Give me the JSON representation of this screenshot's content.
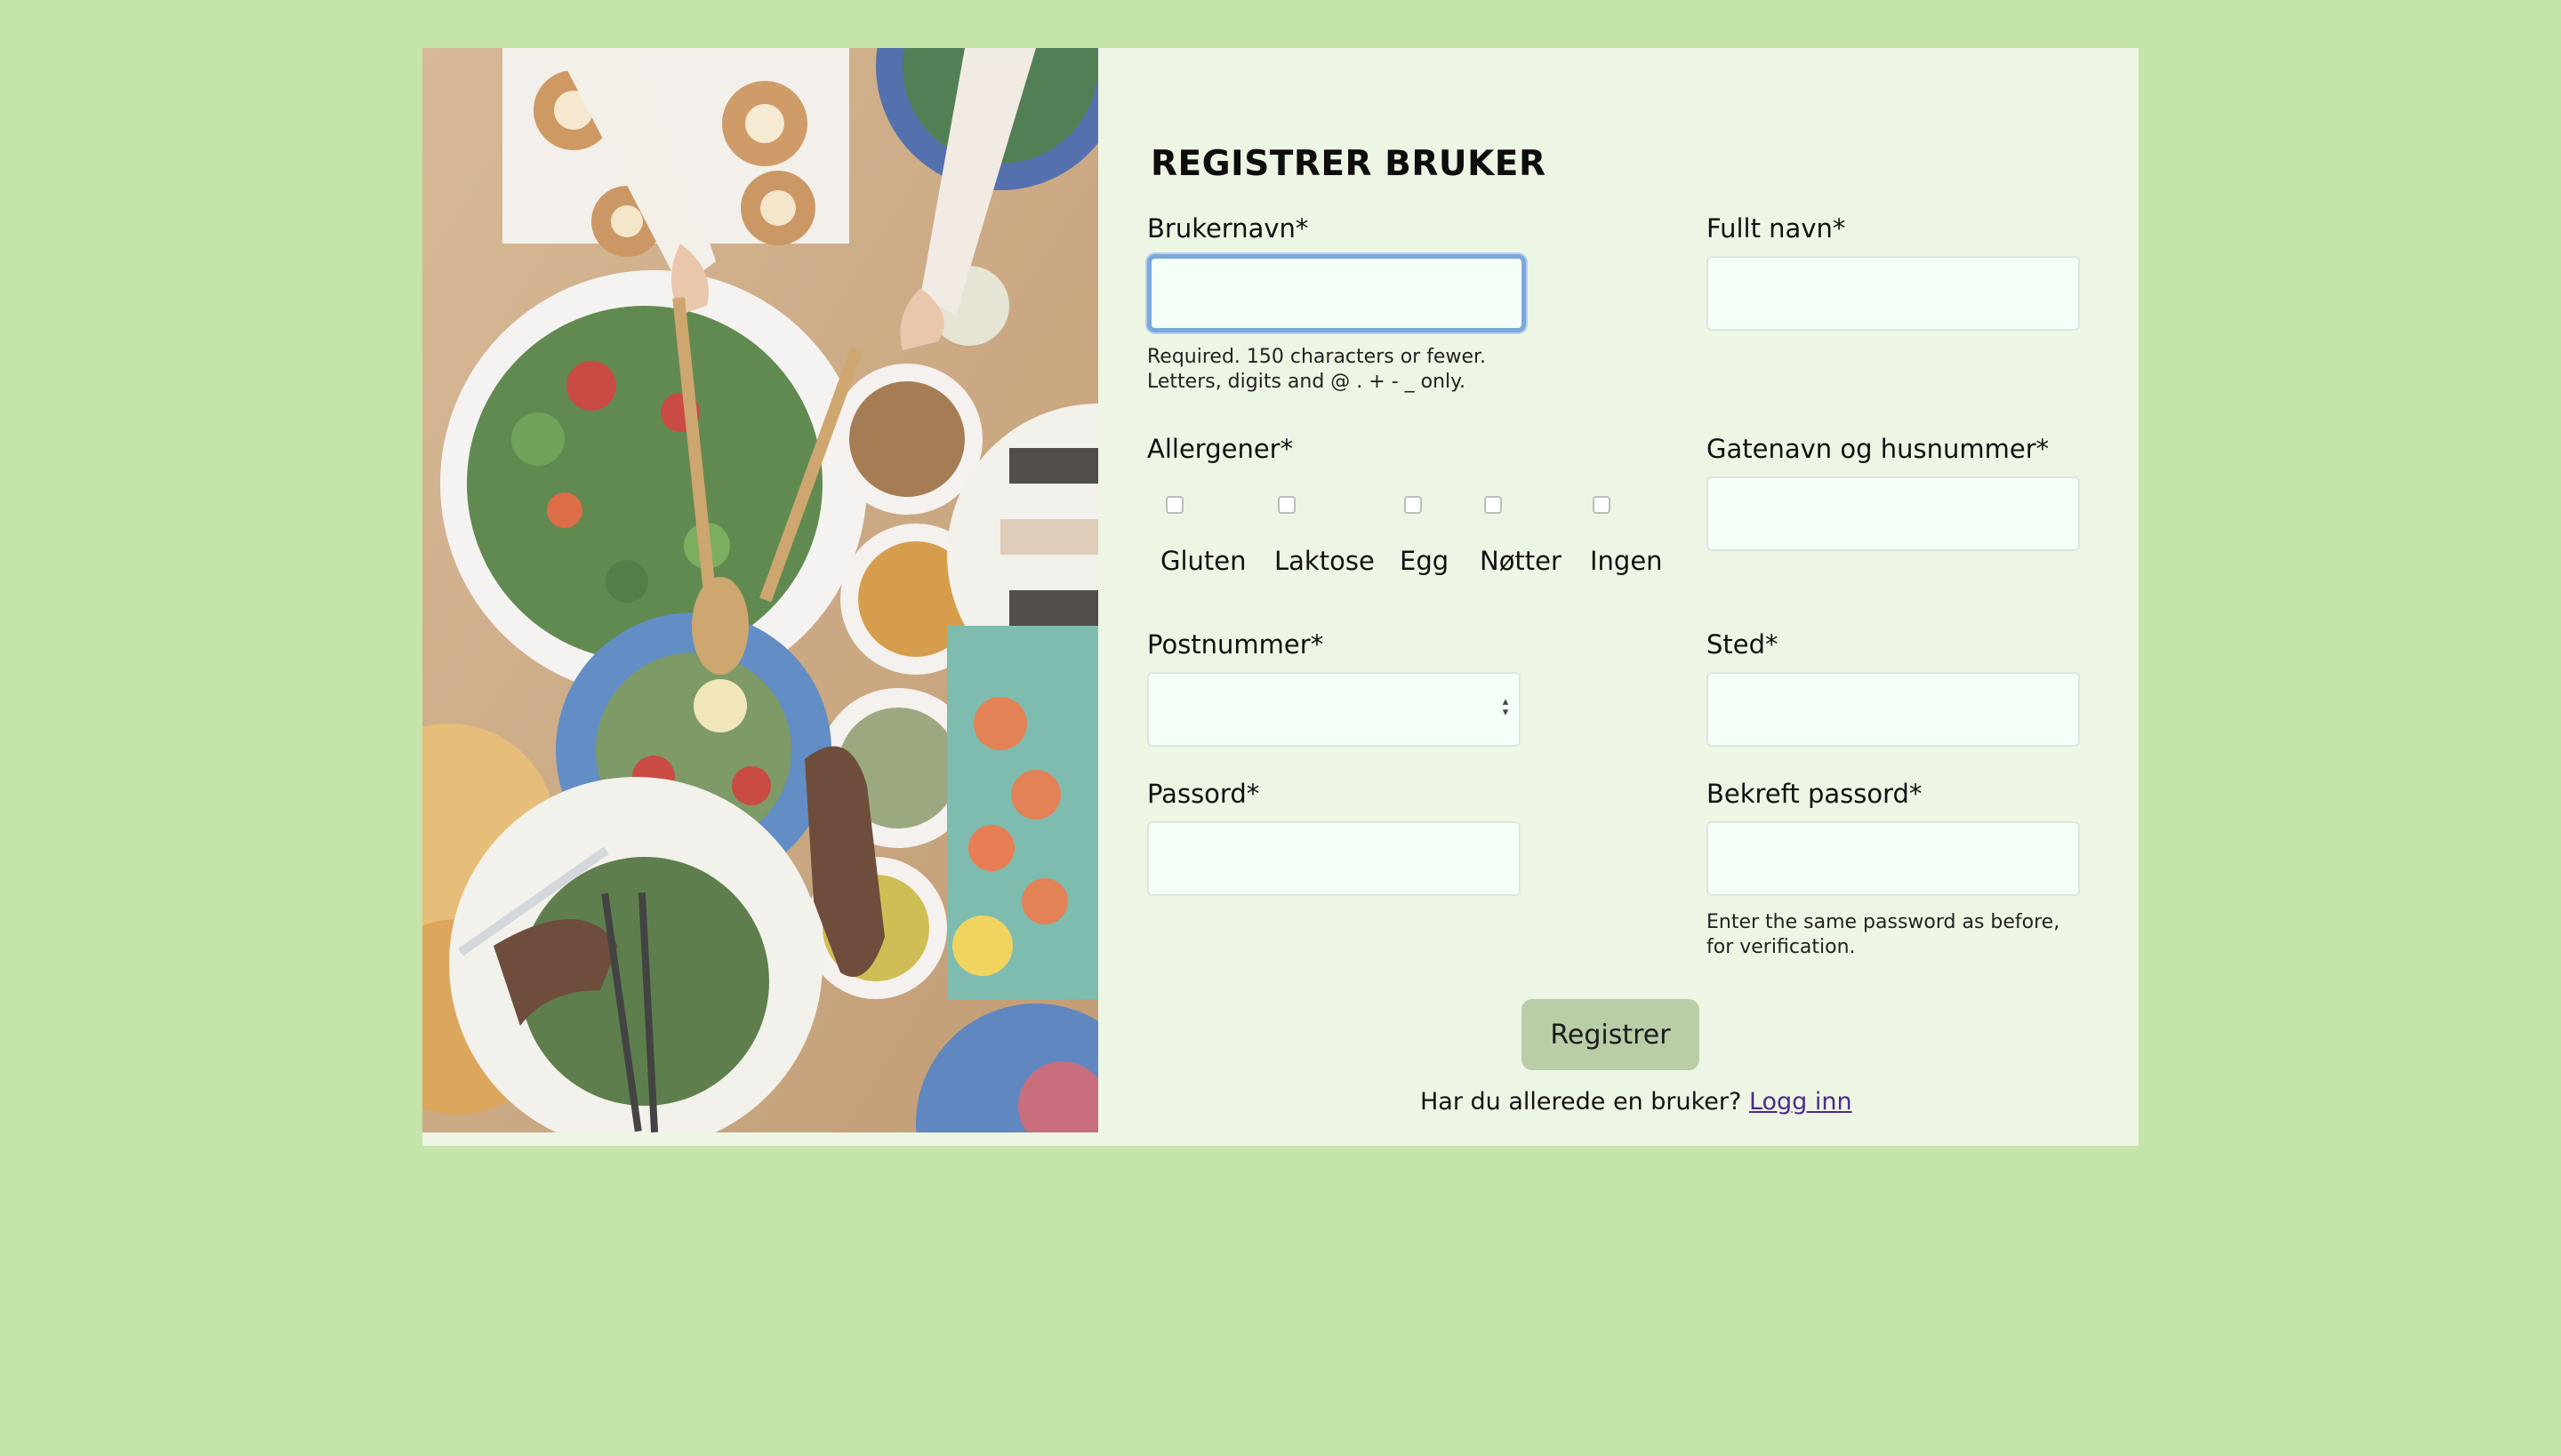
{
  "form": {
    "title": "REGISTRER BRUKER",
    "username_label": "Brukernavn*",
    "username_help_line1": "Required. 150 characters or fewer.",
    "username_help_line2": "Letters, digits and @ . + - _ only.",
    "fullname_label": "Fullt navn*",
    "allergens_label": "Allergener*",
    "allergens": [
      "Gluten",
      "Laktose",
      "Egg",
      "Nøtter",
      "Ingen"
    ],
    "street_label": "Gatenavn og husnummer*",
    "postal_label": "Postnummer*",
    "city_label": "Sted*",
    "password_label": "Passord*",
    "confirm_label": "Bekreft passord*",
    "confirm_help_line1": "Enter the same password as before,",
    "confirm_help_line2": "for verification.",
    "submit_label": "Registrer",
    "login_prompt": "Har du allerede en bruker?",
    "login_link": "Logg inn"
  },
  "colors": {
    "background": "#c4e4a9",
    "card": "#edf6e4",
    "button": "#b9cda7",
    "focus_border": "#7aa8dc",
    "link": "#4b2a8a"
  }
}
